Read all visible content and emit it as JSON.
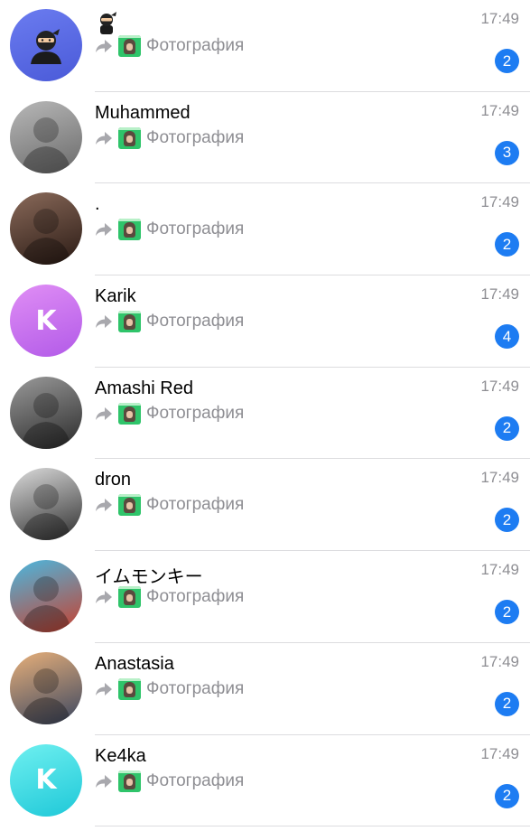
{
  "chats": [
    {
      "name": "",
      "name_icon": "ninja-emoji-icon",
      "time": "17:49",
      "preview": "Фотография",
      "unread": "2",
      "avatar": {
        "type": "ninja",
        "colors": [
          "#6b7cf0",
          "#4a5ad8"
        ]
      }
    },
    {
      "name": "Muhammed",
      "time": "17:49",
      "preview": "Фотография",
      "unread": "3",
      "avatar": {
        "type": "photo",
        "colors": [
          "#b8b8b8",
          "#6a6a6a"
        ]
      }
    },
    {
      "name": ".",
      "time": "17:49",
      "preview": "Фотография",
      "unread": "2",
      "avatar": {
        "type": "photo",
        "colors": [
          "#8a6a5a",
          "#2a1a14"
        ]
      }
    },
    {
      "name": "Karik",
      "time": "17:49",
      "preview": "Фотография",
      "unread": "4",
      "avatar": {
        "type": "letter",
        "letter": "K",
        "colors": [
          "#e08ef5",
          "#b25ae8"
        ]
      }
    },
    {
      "name": "Amashi Red",
      "time": "17:49",
      "preview": "Фотография",
      "unread": "2",
      "avatar": {
        "type": "photo",
        "colors": [
          "#9a9a9a",
          "#2a2a2a"
        ]
      }
    },
    {
      "name": "dron",
      "time": "17:49",
      "preview": "Фотография",
      "unread": "2",
      "avatar": {
        "type": "photo",
        "colors": [
          "#dcdcdc",
          "#2e2e2e"
        ]
      }
    },
    {
      "name": "イムモンキー",
      "time": "17:49",
      "preview": "Фотография",
      "unread": "2",
      "avatar": {
        "type": "photo",
        "colors": [
          "#4ab8e0",
          "#c8402e"
        ]
      }
    },
    {
      "name": "Anastasia",
      "time": "17:49",
      "preview": "Фотография",
      "unread": "2",
      "avatar": {
        "type": "photo",
        "colors": [
          "#e8b07a",
          "#3a4660"
        ]
      }
    },
    {
      "name": "Ke4ka",
      "time": "17:49",
      "preview": "Фотография",
      "unread": "2",
      "avatar": {
        "type": "letter",
        "letter": "K",
        "colors": [
          "#6ff0f0",
          "#1ec8d8"
        ]
      }
    }
  ],
  "colors": {
    "badge": "#1d7cf2",
    "muted_text": "#8e8e93",
    "forward_icon": "#a8a8ad"
  },
  "icons": {
    "forward": "forward-arrow-icon",
    "photo_thumbnail": "photo-thumbnail-icon"
  }
}
